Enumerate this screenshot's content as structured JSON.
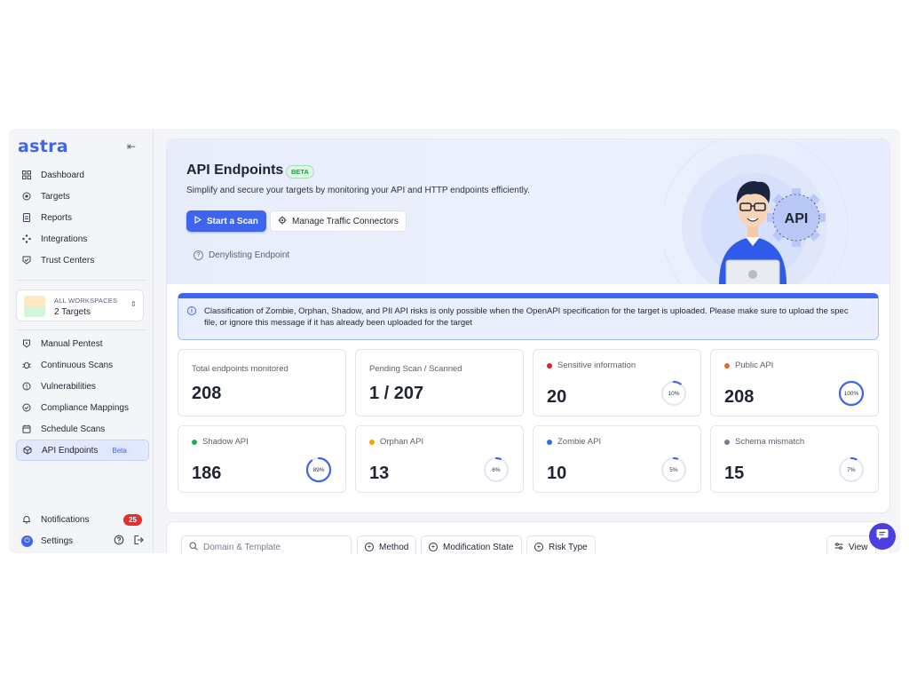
{
  "brand": {
    "logo_text": "astra"
  },
  "sidebar": {
    "collapse_glyph": "⇤",
    "items_top": [
      {
        "label": "Dashboard",
        "icon": "grid-icon"
      },
      {
        "label": "Targets",
        "icon": "target-icon"
      },
      {
        "label": "Reports",
        "icon": "report-icon"
      },
      {
        "label": "Integrations",
        "icon": "integrations-icon"
      },
      {
        "label": "Trust Centers",
        "icon": "shield-check-icon"
      }
    ],
    "workspace": {
      "label": "ALL WORKSPACES",
      "value": "2 Targets"
    },
    "items_bottom": [
      {
        "label": "Manual Pentest",
        "icon": "shield-icon"
      },
      {
        "label": "Continuous Scans",
        "icon": "bug-icon"
      },
      {
        "label": "Vulnerabilities",
        "icon": "alert-circle-icon"
      },
      {
        "label": "Compliance Mappings",
        "icon": "check-circle-icon"
      },
      {
        "label": "Schedule Scans",
        "icon": "calendar-icon"
      },
      {
        "label": "API Endpoints",
        "icon": "cube-icon",
        "badge": "Beta",
        "active": true
      }
    ],
    "notifications": {
      "label": "Notifications",
      "count": "25"
    },
    "settings": {
      "label": "Settings"
    }
  },
  "hero": {
    "title": "API Endpoints",
    "beta": "BETA",
    "subtitle": "Simplify and secure your targets by monitoring your API and HTTP endpoints efficiently.",
    "start_scan": "Start a Scan",
    "manage_connectors": "Manage Traffic Connectors",
    "denylist": "Denylisting Endpoint",
    "illustration_text": "API"
  },
  "info_banner": {
    "text": "Classification of Zombie, Orphan, Shadow, and PII API risks is only possible when the OpenAPI specification for the target is uploaded. Please make sure to upload the spec file, or ignore this message if it has already been uploaded for the target"
  },
  "stats": [
    {
      "label": "Total endpoints monitored",
      "value": "208"
    },
    {
      "label": "Pending Scan / Scanned",
      "value": "1 / 207"
    },
    {
      "label": "Sensitive information",
      "value": "20",
      "percent": 10,
      "percent_label": "10%",
      "dot": "#e02424"
    },
    {
      "label": "Public API",
      "value": "208",
      "percent": 100,
      "percent_label": "100%",
      "dot": "#e06a24"
    },
    {
      "label": "Shadow API",
      "value": "186",
      "percent": 89,
      "percent_label": "89%",
      "dot": "#22b04b"
    },
    {
      "label": "Orphan API",
      "value": "13",
      "percent": 6,
      "percent_label": "6%",
      "dot": "#f0a500"
    },
    {
      "label": "Zombie API",
      "value": "10",
      "percent": 5,
      "percent_label": "5%",
      "dot": "#2f6bf0"
    },
    {
      "label": "Schema mismatch",
      "value": "15",
      "percent": 7,
      "percent_label": "7%",
      "dot": "#7a7f8e"
    }
  ],
  "filters": {
    "search_placeholder": "Domain & Template",
    "method": "Method",
    "modification_state": "Modification State",
    "risk_type": "Risk Type",
    "view": "View"
  },
  "colors": {
    "accent": "#3f64ee",
    "ring_track": "#e3e7f0",
    "danger": "#e23030"
  }
}
